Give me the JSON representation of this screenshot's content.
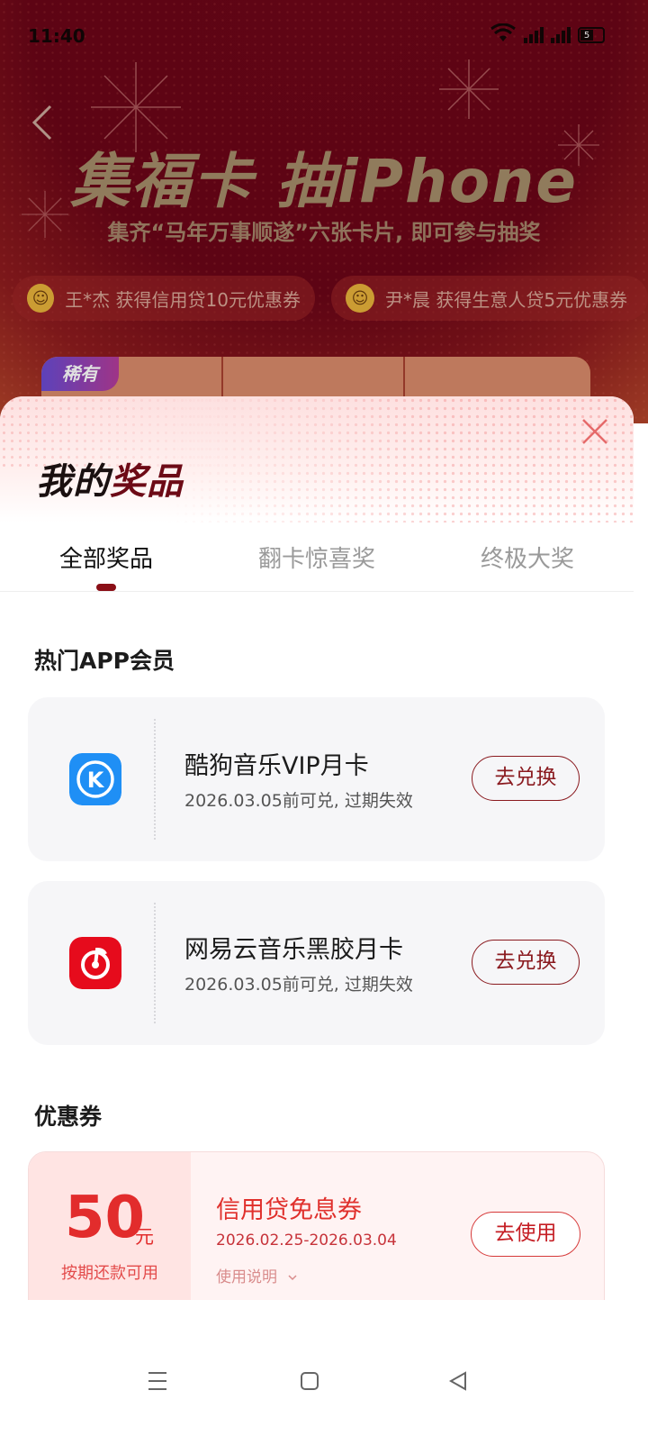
{
  "status_bar": {
    "time": "11:40",
    "battery": "5"
  },
  "banner": {
    "title": "集福卡 抽iPhone",
    "subtitle": "集齐“马年万事顺遂”六张卡片, 即可参与抽奖",
    "ticker": [
      {
        "text": "王*杰 获得信用贷10元优惠券"
      },
      {
        "text": "尹*晨 获得生意人贷5元优惠券"
      }
    ],
    "rare_badge": "稀有"
  },
  "sheet": {
    "title_plain": "我的",
    "title_accent": "奖品",
    "tabs": [
      {
        "label": "全部奖品",
        "active": true
      },
      {
        "label": "翻卡惊喜奖",
        "active": false
      },
      {
        "label": "终极大奖",
        "active": false
      }
    ],
    "sections": {
      "vip": {
        "title": "热门APP会员",
        "items": [
          {
            "icon": "kugou-music-icon",
            "name": "酷狗音乐VIP月卡",
            "expire": "2026.03.05前可兑, 过期失效",
            "button": "去兑换"
          },
          {
            "icon": "netease-music-icon",
            "name": "网易云音乐黑胶月卡",
            "expire": "2026.03.05前可兑, 过期失效",
            "button": "去兑换"
          }
        ]
      },
      "coupons": {
        "title": "优惠券",
        "items": [
          {
            "amount": "50",
            "unit": "元",
            "condition": "按期还款可用",
            "name": "信用贷免息券",
            "date_range": "2026.02.25-2026.03.04",
            "help": "使用说明",
            "button": "去使用"
          }
        ]
      }
    }
  },
  "colors": {
    "accent": "#8a0f17",
    "coupon_red": "#e22c2c",
    "banner_bg": "#6a0517"
  }
}
